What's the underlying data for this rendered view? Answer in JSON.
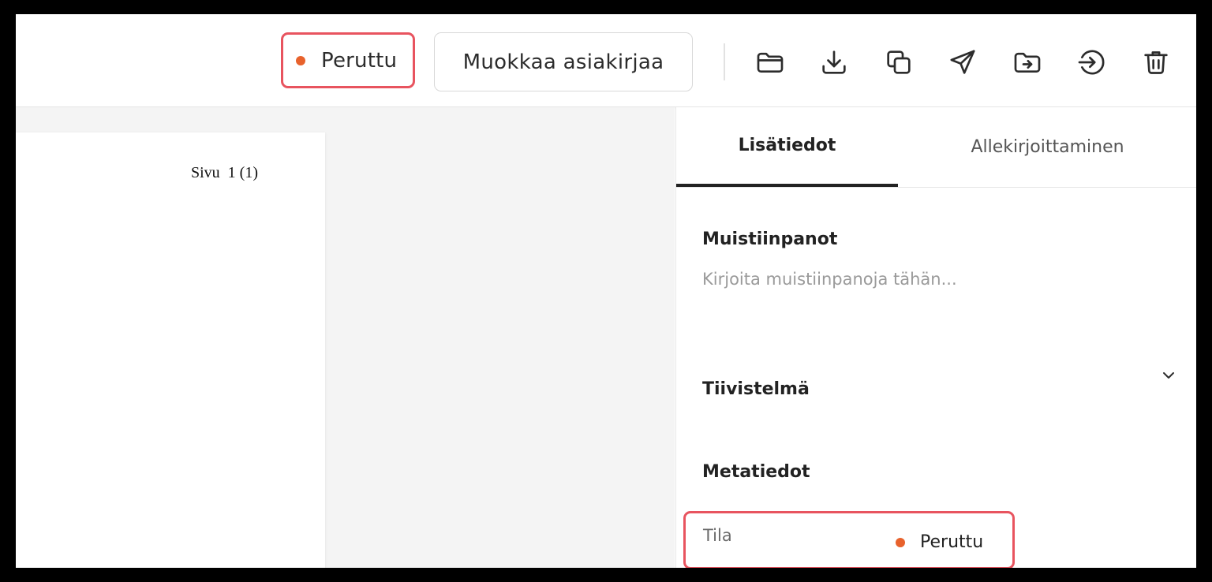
{
  "toolbar": {
    "status": {
      "label": "Peruttu",
      "dot_color": "#e8622c"
    },
    "edit_button": {
      "label": "Muokkaa asiakirjaa"
    },
    "icons": [
      "folder-icon",
      "download-icon",
      "copy-icon",
      "send-icon",
      "move-to-folder-icon",
      "sign-in-icon",
      "trash-icon"
    ]
  },
  "document": {
    "page_number_text": "Sivu  1 (1)"
  },
  "panel": {
    "tabs": [
      {
        "label": "Lisätiedot",
        "active": true
      },
      {
        "label": "Allekirjoittaminen",
        "active": false
      }
    ],
    "notes": {
      "title": "Muistiinpanot",
      "placeholder": "Kirjoita muistiinpanoja tähän...",
      "value": ""
    },
    "summary": {
      "title": "Tiivistelmä",
      "expand_icon": "chevron-down-icon"
    },
    "metadata": {
      "title": "Metatiedot",
      "rows": [
        {
          "key": "Tila",
          "value": "Peruttu",
          "dot_color": "#e8622c"
        }
      ]
    }
  },
  "colors": {
    "highlight_border": "#e8545f",
    "status_dot": "#e8622c"
  }
}
